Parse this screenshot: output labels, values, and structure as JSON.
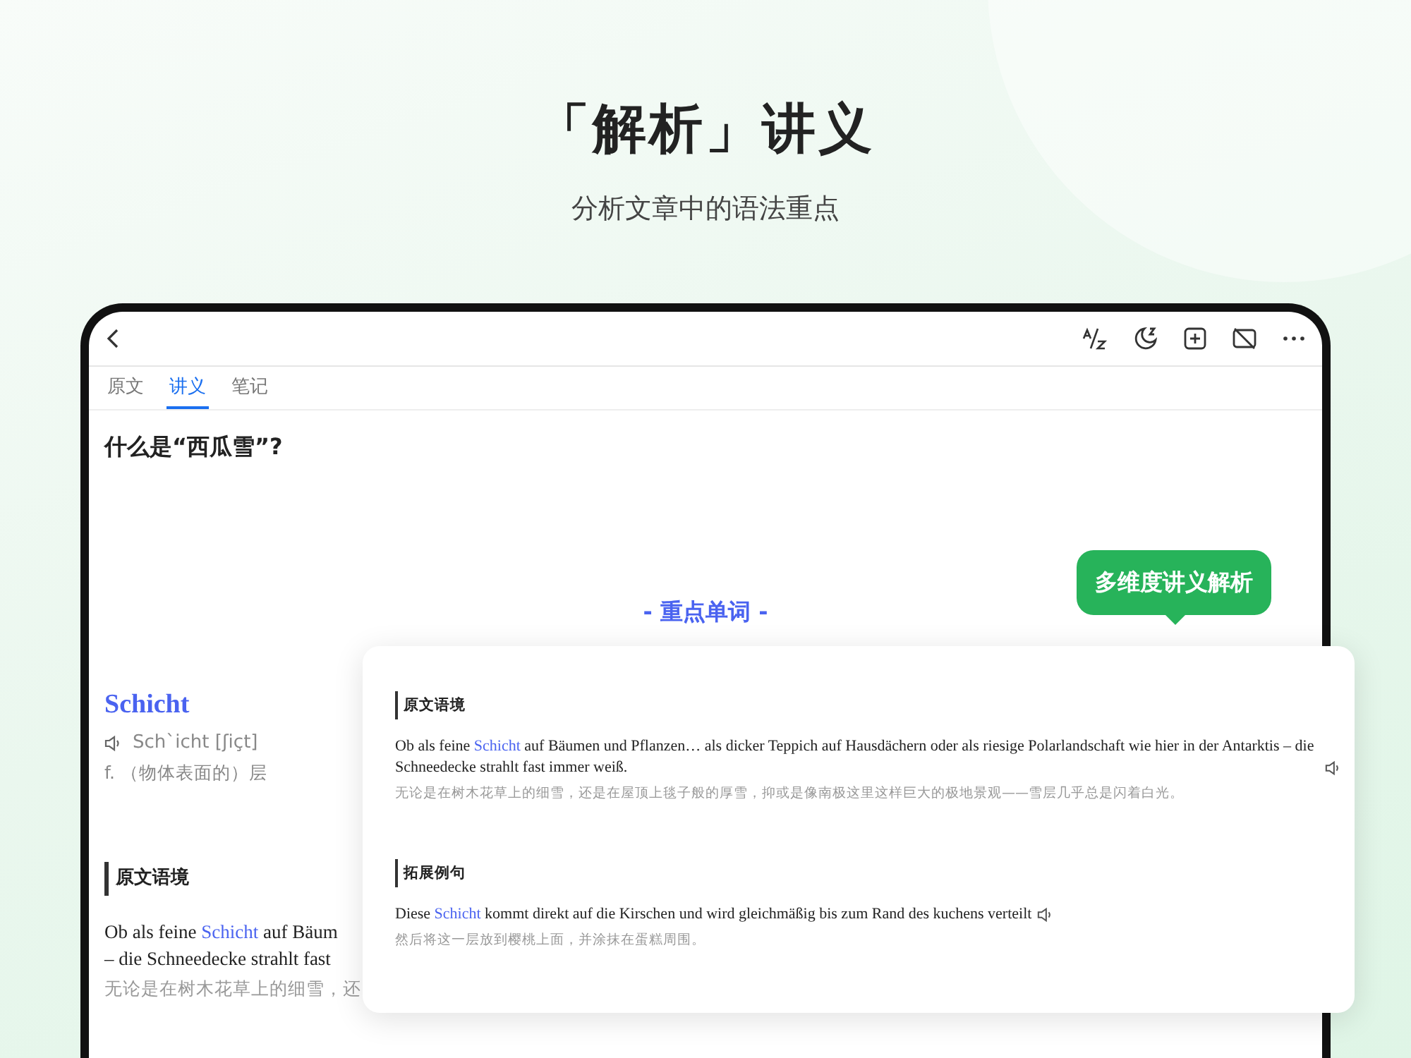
{
  "headline": "「解析」讲义",
  "subheadline": "分析文章中的语法重点",
  "tabs": [
    {
      "label": "原文",
      "selected": false
    },
    {
      "label": "讲义",
      "selected": true
    },
    {
      "label": "笔记",
      "selected": false
    }
  ],
  "question": "什么是“西瓜雪”?",
  "section_title": "- 重点单词 -",
  "bubble": "多维度讲义解析",
  "word": {
    "term": "Schicht",
    "pronunciation": "Sch`icht [ʃiçt]",
    "meaning": "f. （物体表面的）层"
  },
  "context": {
    "title": "原文语境",
    "line1_before": "Ob als feine ",
    "line1_word": "Schicht",
    "line1_after": " auf Bäum",
    "line2": "– die Schneedecke strahlt fast",
    "translation": "无论是在树木花草上的细雪，还"
  },
  "card_sections": [
    {
      "title": "原文语境",
      "before": "Ob als feine ",
      "word": "Schicht",
      "after": " auf Bäumen und Pflanzen… als dicker Teppich auf Hausdächern oder als riesige Polarlandschaft wie hier in der Antarktis – die Schneedecke strahlt fast immer weiß.",
      "translation": "无论是在树木花草上的细雪，还是在屋顶上毯子般的厚雪，抑或是像南极这里这样巨大的极地景观——雪层几乎总是闪着白光。"
    },
    {
      "title": "拓展例句",
      "before": "Diese ",
      "word": "Schicht",
      "after": " kommt direkt auf die Kirschen und wird gleichmäßig bis zum Rand des kuchens verteilt",
      "translation": "然后将这一层放到樱桃上面，并涂抹在蛋糕周围。"
    }
  ]
}
